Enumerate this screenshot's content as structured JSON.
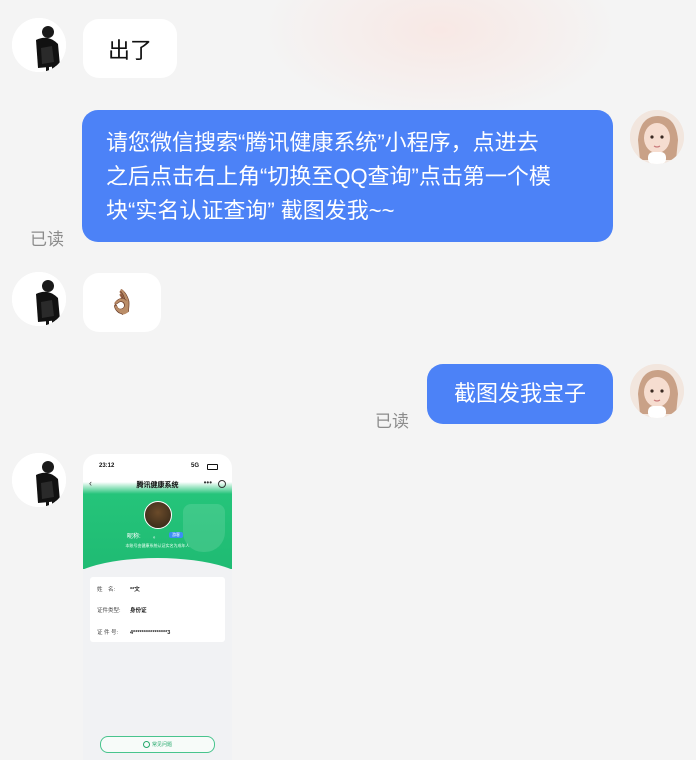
{
  "messages": [
    {
      "from": "them",
      "text": "出了"
    },
    {
      "from": "me",
      "lines": [
        "请您微信搜索“腾讯健康系统”小程序，点进去",
        "之后点击右上角“切换至QQ查询”点击第一个模",
        "块“实名认证查询” 截图发我~~"
      ],
      "status": "已读"
    },
    {
      "from": "them",
      "emoji": "👌🏽"
    },
    {
      "from": "me",
      "text": "截图发我宝子",
      "status": "已读"
    },
    {
      "from": "them",
      "type": "image"
    }
  ],
  "screenshot": {
    "time": "23:12",
    "signal": "5G",
    "nav_title": "腾讯健康系统",
    "nav_dots": "•••",
    "nickname_label": "昵称:",
    "nickname_value": "。",
    "tag": "游客",
    "subtitle": "本账号由健康系统认证实名为成年人",
    "fields": [
      {
        "label": "姓　名:",
        "value": "**文"
      },
      {
        "label": "证件类型:",
        "value": "身份证"
      },
      {
        "label": "证 件 号:",
        "value": "4****************3"
      }
    ],
    "button": "常见问题",
    "button_icon": "question-circle-icon"
  },
  "colors": {
    "outgoing_bubble": "#4c82f7",
    "incoming_bubble": "#ffffff",
    "background": "#f4f4f4",
    "status_text": "#8c8c8c",
    "screenshot_green": "#1fbb73"
  }
}
